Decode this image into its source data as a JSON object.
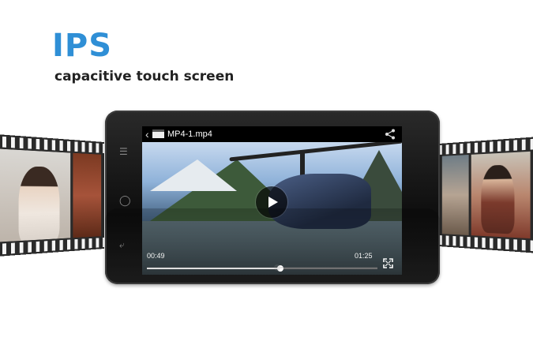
{
  "promo": {
    "headline": "IPS",
    "subline": "capacitive touch screen"
  },
  "player": {
    "file_name": "MP4-1.mp4",
    "current_time": "00:49",
    "total_time": "01:25",
    "progress": 0.58
  },
  "icons": {
    "back": "back-icon",
    "clapper": "clapperboard-icon",
    "share": "share-icon",
    "play": "play-icon",
    "fullscreen": "fullscreen-icon",
    "phone_softkeys": [
      "menu-icon",
      "home-icon",
      "back-icon"
    ]
  },
  "colors": {
    "headline": "#2f8fd6",
    "subline": "#222222",
    "phone_body": "#111111"
  }
}
